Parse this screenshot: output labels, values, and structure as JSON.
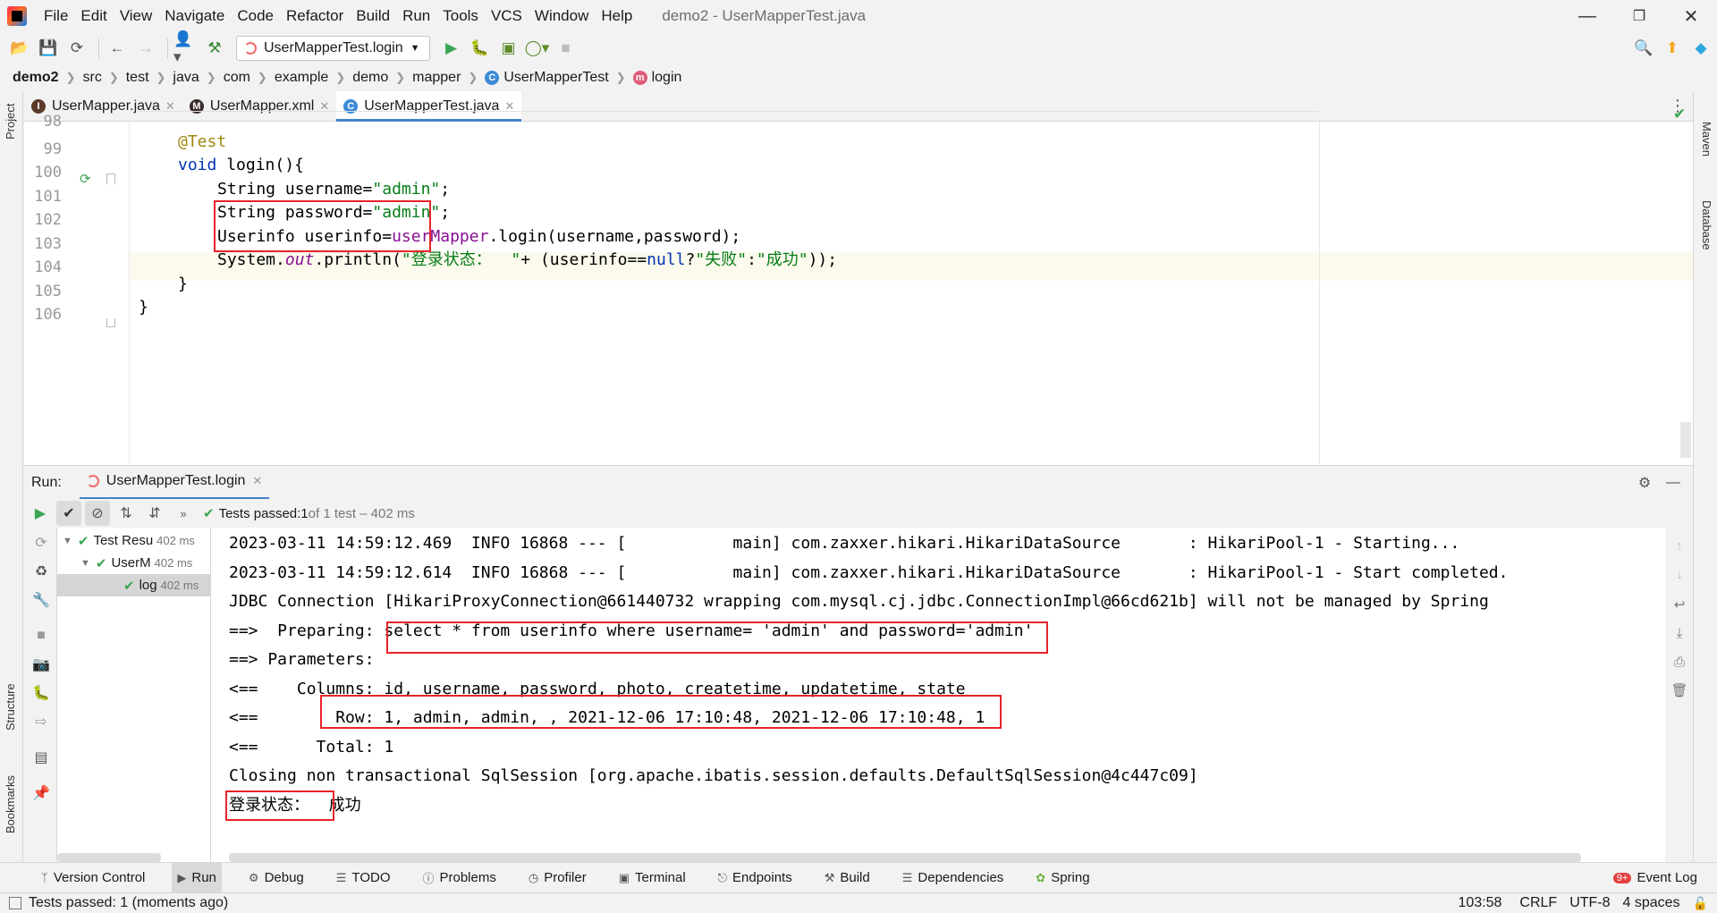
{
  "app": {
    "window_title": "demo2 - UserMapperTest.java"
  },
  "menu": [
    "File",
    "Edit",
    "View",
    "Navigate",
    "Code",
    "Refactor",
    "Build",
    "Run",
    "Tools",
    "VCS",
    "Window",
    "Help"
  ],
  "toolbar": {
    "run_config": "UserMapperTest.login"
  },
  "breadcrumb": [
    "demo2",
    "src",
    "test",
    "java",
    "com",
    "example",
    "demo",
    "mapper",
    "UserMapperTest",
    "login"
  ],
  "side_tools": {
    "project": "Project",
    "structure": "Structure",
    "bookmarks": "Bookmarks",
    "maven": "Maven",
    "database": "Database"
  },
  "editor_tabs": [
    {
      "label": "UserMapper.java",
      "active": false
    },
    {
      "label": "UserMapper.xml",
      "active": false
    },
    {
      "label": "UserMapperTest.java",
      "active": true
    }
  ],
  "editor": {
    "line_numbers": [
      "98",
      "99",
      "100",
      "101",
      "102",
      "103",
      "104",
      "105",
      "106"
    ],
    "code": {
      "l99_annotation": "@Test",
      "l100_kw": "void",
      "l100_rest": " login(){",
      "l101_type": "String username=",
      "l101_str": "\"admin\"",
      "l101_end": ";",
      "l102_type": "String password=",
      "l102_str": "\"admin\"",
      "l102_end": ";",
      "l103_a": "Userinfo userinfo=",
      "l103_field": "userMapper",
      "l103_b": ".login(username,password);",
      "l104_a": "System.",
      "l104_out": "out",
      "l104_b": ".println(",
      "l104_s1": "\"登录状态：  \"",
      "l104_c": "+ (userinfo==",
      "l104_null": "null",
      "l104_d": "?",
      "l104_s2": "\"失败\"",
      "l104_e": ":",
      "l104_s3": "\"成功\"",
      "l104_f": "));",
      "l105": "}",
      "l106": "}"
    }
  },
  "run_panel": {
    "label": "Run:",
    "tab": "UserMapperTest.login",
    "tests_passed_label": "Tests passed: ",
    "tests_passed_count": "1",
    "tests_passed_detail": " of 1 test – 402 ms"
  },
  "test_tree": [
    {
      "label": "Test Resu",
      "time": "402 ms"
    },
    {
      "label": "UserM",
      "time": "402 ms"
    },
    {
      "label": "log",
      "time": "402 ms"
    }
  ],
  "console": [
    "2023-03-11 14:59:12.469  INFO 16868 --- [           main] com.zaxxer.hikari.HikariDataSource       : HikariPool-1 - Starting...",
    "2023-03-11 14:59:12.614  INFO 16868 --- [           main] com.zaxxer.hikari.HikariDataSource       : HikariPool-1 - Start completed.",
    "JDBC Connection [HikariProxyConnection@661440732 wrapping com.mysql.cj.jdbc.ConnectionImpl@66cd621b] will not be managed by Spring",
    "==>  Preparing: select * from userinfo where username= 'admin' and password='admin'",
    "==> Parameters: ",
    "<==    Columns: id, username, password, photo, createtime, updatetime, state",
    "<==        Row: 1, admin, admin, , 2021-12-06 17:10:48, 2021-12-06 17:10:48, 1",
    "<==      Total: 1",
    "Closing non transactional SqlSession [org.apache.ibatis.session.defaults.DefaultSqlSession@4c447c09]",
    "登录状态：  成功"
  ],
  "bottom_tools": [
    "Version Control",
    "Run",
    "Debug",
    "TODO",
    "Problems",
    "Profiler",
    "Terminal",
    "Endpoints",
    "Build",
    "Dependencies",
    "Spring"
  ],
  "event_log": {
    "badge": "9+",
    "label": "Event Log"
  },
  "status": {
    "message": "Tests passed: 1 (moments ago)",
    "position": "103:58",
    "line_sep": "CRLF",
    "encoding": "UTF-8",
    "indent": "4 spaces"
  },
  "colors": {
    "accent": "#4083c9",
    "highlight_box": "#e8232a",
    "pass_green": "#3aa655"
  }
}
